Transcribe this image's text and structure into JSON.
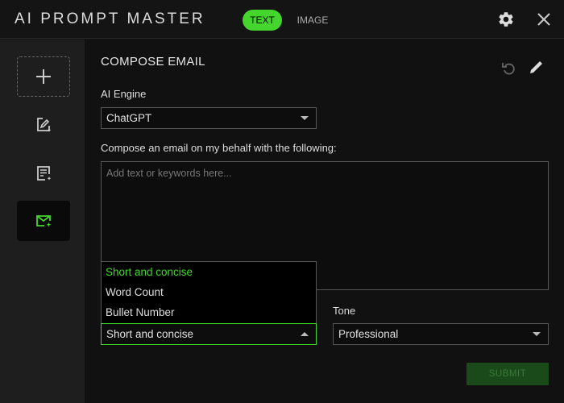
{
  "app": {
    "title": "AI PROMPT MASTER"
  },
  "tabs": [
    {
      "label": "TEXT",
      "active": true
    },
    {
      "label": "IMAGE",
      "active": false
    }
  ],
  "header_icons": [
    "gear-icon",
    "close-icon"
  ],
  "sidebar": {
    "items": [
      {
        "icon": "plus-icon"
      },
      {
        "icon": "image-edit-icon"
      },
      {
        "icon": "document-edit-icon"
      },
      {
        "icon": "email-compose-icon",
        "active": true
      }
    ]
  },
  "main": {
    "heading": "COMPOSE EMAIL",
    "ai_engine": {
      "label": "AI Engine",
      "value": "ChatGPT"
    },
    "compose": {
      "label": "Compose an email on my behalf with the following:",
      "placeholder": "Add text or keywords here..."
    },
    "length": {
      "value": "Short and concise",
      "options": [
        "Short and concise",
        "Word Count",
        "Bullet Number"
      ]
    },
    "tone": {
      "label": "Tone",
      "value": "Professional"
    },
    "submit_label": "SUBMIT"
  },
  "colors": {
    "accent": "#44d62c",
    "background": "#111111",
    "sidebar": "#1e1e1e"
  }
}
